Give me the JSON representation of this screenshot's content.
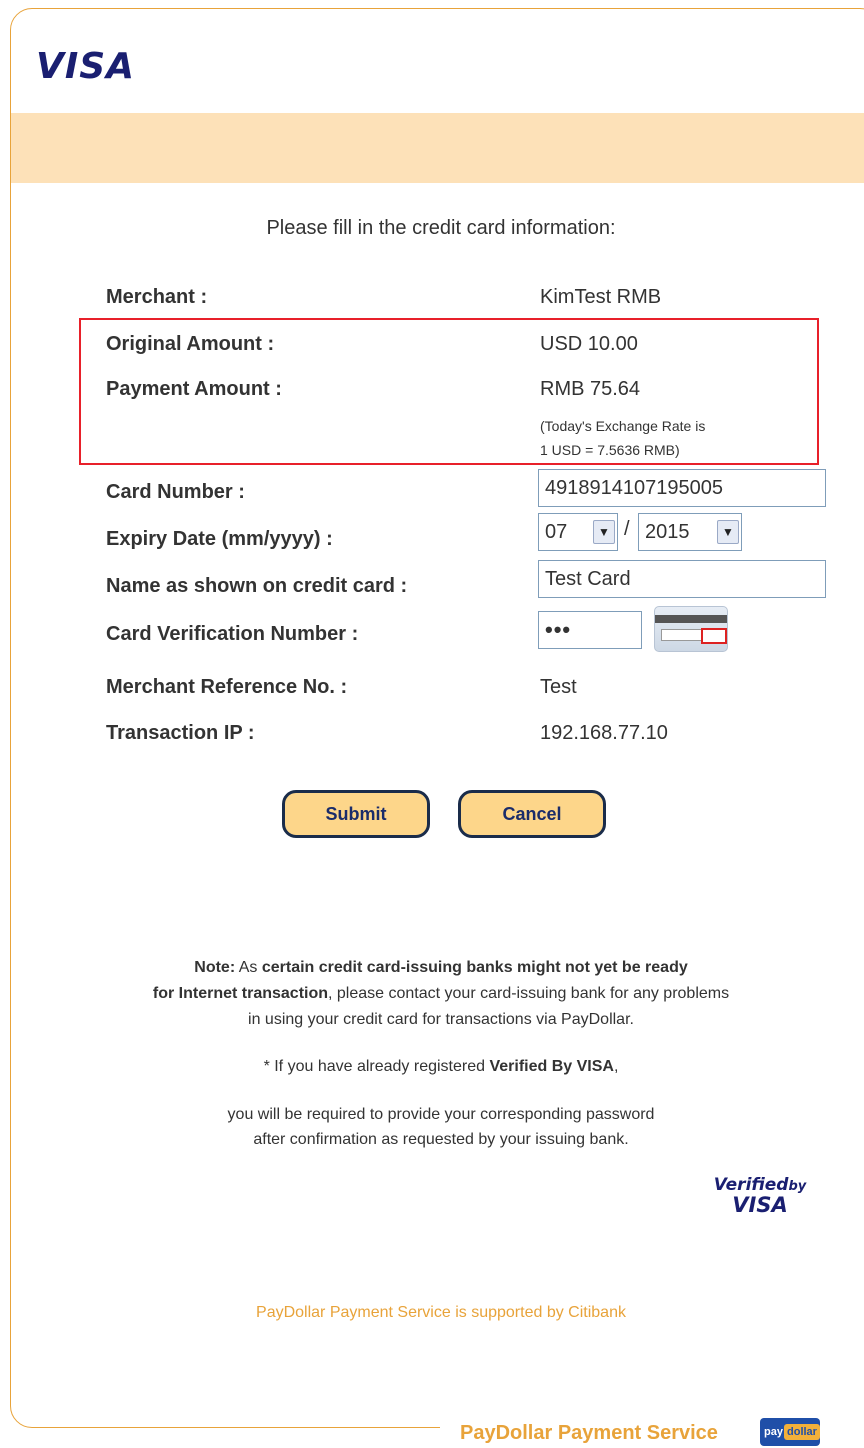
{
  "header": {
    "logo_text": "VISA"
  },
  "instruction": "Please fill in the credit card information:",
  "details": {
    "merchant": {
      "label": "Merchant :",
      "value": "KimTest RMB"
    },
    "original_amount": {
      "label": "Original Amount :",
      "value": "USD 10.00"
    },
    "payment_amount": {
      "label": "Payment Amount :",
      "value": "RMB 75.64"
    },
    "exchange_rate_line1": "(Today's Exchange Rate is",
    "exchange_rate_line2": "1 USD = 7.5636 RMB)"
  },
  "form": {
    "card_number": {
      "label": "Card Number :",
      "value": "4918914107195005"
    },
    "expiry": {
      "label": "Expiry Date (mm/yyyy) :",
      "month": "07",
      "separator": "/",
      "year": "2015"
    },
    "name": {
      "label": "Name as shown on credit card :",
      "value": "Test Card"
    },
    "cvv": {
      "label": "Card Verification Number :",
      "value": "•••"
    },
    "merchant_ref": {
      "label": "Merchant Reference No. :",
      "value": "Test"
    },
    "transaction_ip": {
      "label": "Transaction IP :",
      "value": "192.168.77.10"
    }
  },
  "buttons": {
    "submit": "Submit",
    "cancel": "Cancel"
  },
  "note": {
    "lead": "Note:",
    "part1": " As ",
    "bold1": "certain credit card-issuing banks might not yet be ready",
    "bold2": "for Internet transaction",
    "part2": ", please contact your card-issuing bank for any problems",
    "line3": "in using your credit card for transactions via PayDollar.",
    "vbv_pre": "* If you have already registered ",
    "vbv_bold": "Verified By VISA",
    "vbv_post": ",",
    "req_line1": "you will be required to provide your corresponding password",
    "req_line2": "after confirmation as requested by your issuing bank."
  },
  "verified_by_visa": {
    "line1": "Verified",
    "by": "by",
    "line2": "VISA"
  },
  "citibank_text": "PayDollar Payment Service is supported by Citibank",
  "footer": {
    "service_text": "PayDollar Payment Service",
    "logo_pay": "pay",
    "logo_dollar": "dollar"
  },
  "colors": {
    "accent": "#e8a33a",
    "band": "#fde1b8",
    "highlight": "#e8202a",
    "visa_blue": "#1a1f71"
  }
}
